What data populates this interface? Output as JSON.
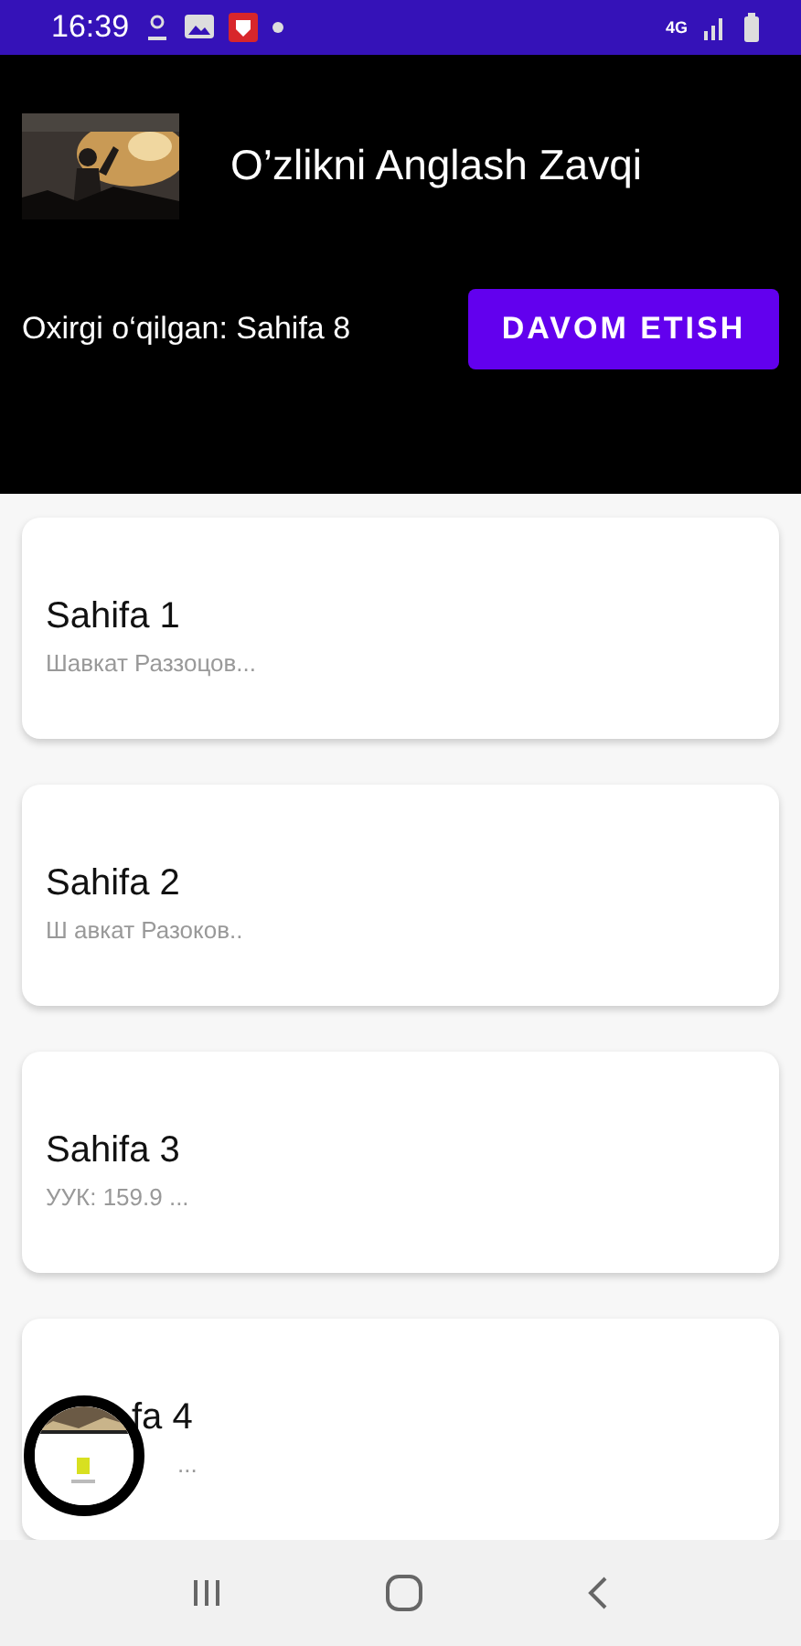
{
  "status_bar": {
    "time": "16:39",
    "network": "4G"
  },
  "header": {
    "title": "O’zlikni Anglash Zavqi",
    "last_read": "Oxirgi o‘qilgan: Sahifa 8",
    "button": "DAVOM ETISH"
  },
  "pages": [
    {
      "kind": "full",
      "title": "Sahifa 1",
      "subtitle": "Шавкат Раззоцов..."
    },
    {
      "kind": "full",
      "title": "Sahifa 2",
      "subtitle": "Ш авкат Разоков.."
    },
    {
      "kind": "full",
      "title": "Sahifa 3",
      "subtitle": "УУК: 159.9 ..."
    },
    {
      "kind": "covered",
      "title": "fa 4",
      "subtitle": "..."
    }
  ]
}
